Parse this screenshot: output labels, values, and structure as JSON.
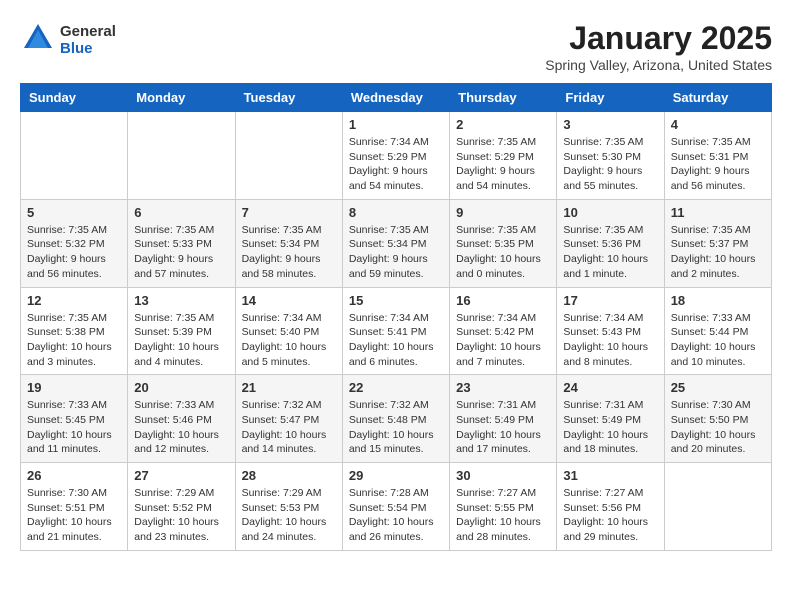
{
  "header": {
    "logo_line1": "General",
    "logo_line2": "Blue",
    "title": "January 2025",
    "location": "Spring Valley, Arizona, United States"
  },
  "calendar": {
    "days_of_week": [
      "Sunday",
      "Monday",
      "Tuesday",
      "Wednesday",
      "Thursday",
      "Friday",
      "Saturday"
    ],
    "weeks": [
      [
        {
          "day": "",
          "info": ""
        },
        {
          "day": "",
          "info": ""
        },
        {
          "day": "",
          "info": ""
        },
        {
          "day": "1",
          "info": "Sunrise: 7:34 AM\nSunset: 5:29 PM\nDaylight: 9 hours\nand 54 minutes."
        },
        {
          "day": "2",
          "info": "Sunrise: 7:35 AM\nSunset: 5:29 PM\nDaylight: 9 hours\nand 54 minutes."
        },
        {
          "day": "3",
          "info": "Sunrise: 7:35 AM\nSunset: 5:30 PM\nDaylight: 9 hours\nand 55 minutes."
        },
        {
          "day": "4",
          "info": "Sunrise: 7:35 AM\nSunset: 5:31 PM\nDaylight: 9 hours\nand 56 minutes."
        }
      ],
      [
        {
          "day": "5",
          "info": "Sunrise: 7:35 AM\nSunset: 5:32 PM\nDaylight: 9 hours\nand 56 minutes."
        },
        {
          "day": "6",
          "info": "Sunrise: 7:35 AM\nSunset: 5:33 PM\nDaylight: 9 hours\nand 57 minutes."
        },
        {
          "day": "7",
          "info": "Sunrise: 7:35 AM\nSunset: 5:34 PM\nDaylight: 9 hours\nand 58 minutes."
        },
        {
          "day": "8",
          "info": "Sunrise: 7:35 AM\nSunset: 5:34 PM\nDaylight: 9 hours\nand 59 minutes."
        },
        {
          "day": "9",
          "info": "Sunrise: 7:35 AM\nSunset: 5:35 PM\nDaylight: 10 hours\nand 0 minutes."
        },
        {
          "day": "10",
          "info": "Sunrise: 7:35 AM\nSunset: 5:36 PM\nDaylight: 10 hours\nand 1 minute."
        },
        {
          "day": "11",
          "info": "Sunrise: 7:35 AM\nSunset: 5:37 PM\nDaylight: 10 hours\nand 2 minutes."
        }
      ],
      [
        {
          "day": "12",
          "info": "Sunrise: 7:35 AM\nSunset: 5:38 PM\nDaylight: 10 hours\nand 3 minutes."
        },
        {
          "day": "13",
          "info": "Sunrise: 7:35 AM\nSunset: 5:39 PM\nDaylight: 10 hours\nand 4 minutes."
        },
        {
          "day": "14",
          "info": "Sunrise: 7:34 AM\nSunset: 5:40 PM\nDaylight: 10 hours\nand 5 minutes."
        },
        {
          "day": "15",
          "info": "Sunrise: 7:34 AM\nSunset: 5:41 PM\nDaylight: 10 hours\nand 6 minutes."
        },
        {
          "day": "16",
          "info": "Sunrise: 7:34 AM\nSunset: 5:42 PM\nDaylight: 10 hours\nand 7 minutes."
        },
        {
          "day": "17",
          "info": "Sunrise: 7:34 AM\nSunset: 5:43 PM\nDaylight: 10 hours\nand 8 minutes."
        },
        {
          "day": "18",
          "info": "Sunrise: 7:33 AM\nSunset: 5:44 PM\nDaylight: 10 hours\nand 10 minutes."
        }
      ],
      [
        {
          "day": "19",
          "info": "Sunrise: 7:33 AM\nSunset: 5:45 PM\nDaylight: 10 hours\nand 11 minutes."
        },
        {
          "day": "20",
          "info": "Sunrise: 7:33 AM\nSunset: 5:46 PM\nDaylight: 10 hours\nand 12 minutes."
        },
        {
          "day": "21",
          "info": "Sunrise: 7:32 AM\nSunset: 5:47 PM\nDaylight: 10 hours\nand 14 minutes."
        },
        {
          "day": "22",
          "info": "Sunrise: 7:32 AM\nSunset: 5:48 PM\nDaylight: 10 hours\nand 15 minutes."
        },
        {
          "day": "23",
          "info": "Sunrise: 7:31 AM\nSunset: 5:49 PM\nDaylight: 10 hours\nand 17 minutes."
        },
        {
          "day": "24",
          "info": "Sunrise: 7:31 AM\nSunset: 5:49 PM\nDaylight: 10 hours\nand 18 minutes."
        },
        {
          "day": "25",
          "info": "Sunrise: 7:30 AM\nSunset: 5:50 PM\nDaylight: 10 hours\nand 20 minutes."
        }
      ],
      [
        {
          "day": "26",
          "info": "Sunrise: 7:30 AM\nSunset: 5:51 PM\nDaylight: 10 hours\nand 21 minutes."
        },
        {
          "day": "27",
          "info": "Sunrise: 7:29 AM\nSunset: 5:52 PM\nDaylight: 10 hours\nand 23 minutes."
        },
        {
          "day": "28",
          "info": "Sunrise: 7:29 AM\nSunset: 5:53 PM\nDaylight: 10 hours\nand 24 minutes."
        },
        {
          "day": "29",
          "info": "Sunrise: 7:28 AM\nSunset: 5:54 PM\nDaylight: 10 hours\nand 26 minutes."
        },
        {
          "day": "30",
          "info": "Sunrise: 7:27 AM\nSunset: 5:55 PM\nDaylight: 10 hours\nand 28 minutes."
        },
        {
          "day": "31",
          "info": "Sunrise: 7:27 AM\nSunset: 5:56 PM\nDaylight: 10 hours\nand 29 minutes."
        },
        {
          "day": "",
          "info": ""
        }
      ]
    ]
  }
}
